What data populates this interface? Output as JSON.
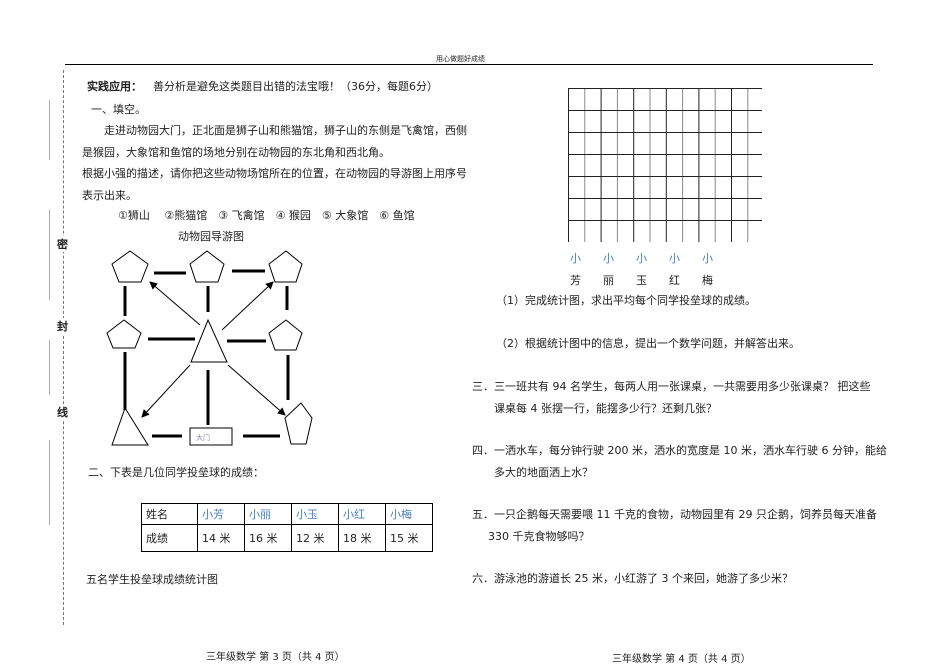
{
  "header": "用心做题好成绩",
  "seal": [
    "密",
    "封",
    "线"
  ],
  "left": {
    "title": "实践应用：",
    "subtitle": "善分析是避免这类题目出错的法宝哦！（36分，每题6分）",
    "q1_heading": "一、填空。",
    "q1_lines": [
      "走进动物园大门，正北面是狮子山和熊猫馆，狮子山的东侧是飞禽馆，西侧",
      "是猴园，大象馆和鱼馆的场地分别在动物园的东北角和西北角。",
      "根据小强的描述，请你把这些动物场馆所在的位置，在动物园的导游图上用序号",
      "表示出来。"
    ],
    "options": "①狮山　 ②熊猫馆　③ 飞禽馆　④ 猴园　⑤ 大象馆　⑥ 鱼馆",
    "map_title": "动物园导游图",
    "gate_label": "大门",
    "q2_heading": "二、下表是几位同学投垒球的成绩：",
    "table": {
      "header": [
        "姓名",
        "小芳",
        "小丽",
        "小玉",
        "小红",
        "小梅"
      ],
      "row": [
        "成绩",
        "14 米",
        "16 米",
        "12 米",
        "18 米",
        "15 米"
      ]
    },
    "chart_title": "五名学生投垒球成绩统计图",
    "footer": "三年级数学  第 3 页（共 4 页）"
  },
  "right": {
    "grid_labels_top": [
      "小",
      "小",
      "小",
      "小",
      "小"
    ],
    "grid_labels_bottom": [
      "芳",
      "丽",
      "玉",
      "红",
      "梅"
    ],
    "q2_1": "（1）完成统计图，求出平均每个同学投垒球的成绩。",
    "q2_2": "（2）根据统计图中的信息，提出一个数学问题，并解答出来。",
    "q3": [
      "三．三一班共有 94 名学生，每两人用一张课桌，一共需要用多少张课桌？  把这些",
      "课桌每 4 张摆一行，能摆多少行？还剩几张？"
    ],
    "q4": [
      "四．一洒水车，每分钟行驶 200 米，洒水的宽度是 10 米，洒水车行驶 6 分钟，能给",
      "多大的地面洒上水？"
    ],
    "q5": [
      "五．一只企鹅每天需要喂 11 千克的食物，动物园里有 29 只企鹅，饲养员每天准备",
      "330 千克食物够吗？"
    ],
    "q6": "六．游泳池的游道长 25 米，小红游了 3 个来回，她游了多少米？",
    "footer": "三年级数学  第 4 页（共 4 页）"
  }
}
